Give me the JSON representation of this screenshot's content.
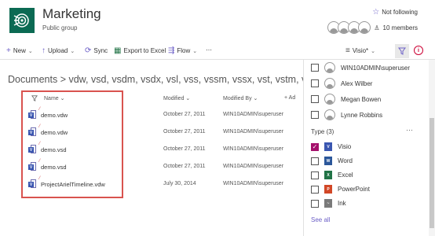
{
  "site": {
    "title": "Marketing",
    "subtitle": "Public group",
    "follow_label": "Not following",
    "members_label": "10 members"
  },
  "commands": {
    "new": "New",
    "upload": "Upload",
    "sync": "Sync",
    "export": "Export to Excel",
    "flow": "Flow",
    "more": "⋯",
    "view": "Visio*"
  },
  "breadcrumb": "Documents  >  vdw, vsd, vsdm, vsdx, vsl, vss, vssm, vssx, vst, vstm, vstx",
  "table": {
    "headers": {
      "name": "Name",
      "modified": "Modified",
      "modified_by": "Modified By",
      "add": "+ Ad"
    },
    "rows": [
      {
        "name": "demo.vdw",
        "modified": "October 27, 2011",
        "by": "WIN10ADMIN\\superuser"
      },
      {
        "name": "demo.vdw",
        "modified": "October 27, 2011",
        "by": "WIN10ADMIN\\superuser"
      },
      {
        "name": "demo.vsd",
        "modified": "October 27, 2011",
        "by": "WIN10ADMIN\\superuser"
      },
      {
        "name": "demo.vsd",
        "modified": "October 27, 2011",
        "by": "WIN10ADMIN\\superuser"
      },
      {
        "name": "ProjectArielTimeline.vdw",
        "modified": "July 30, 2014",
        "by": "WIN10ADMIN\\superuser"
      }
    ]
  },
  "panel": {
    "people": [
      {
        "name": "WIN10ADMIN\\superuser"
      },
      {
        "name": "Alex Wilber"
      },
      {
        "name": "Megan Bowen"
      },
      {
        "name": "Lynne Robbins"
      }
    ],
    "type_title": "Type (3)",
    "more": "⋯",
    "types": [
      {
        "name": "Visio",
        "checked": true,
        "color": "#3a56b0",
        "letter": "V"
      },
      {
        "name": "Word",
        "checked": false,
        "color": "#2b579a",
        "letter": "W"
      },
      {
        "name": "Excel",
        "checked": false,
        "color": "#217346",
        "letter": "X"
      },
      {
        "name": "PowerPoint",
        "checked": false,
        "color": "#d24726",
        "letter": "P"
      },
      {
        "name": "Ink",
        "checked": false,
        "color": "#7a7a7a",
        "letter": "~"
      }
    ],
    "see_all": "See all"
  },
  "colors": {
    "accent": "#6c5fc7",
    "logo": "#0b6a53",
    "highlight_box": "#d9534f",
    "checked": "#a4106b"
  }
}
